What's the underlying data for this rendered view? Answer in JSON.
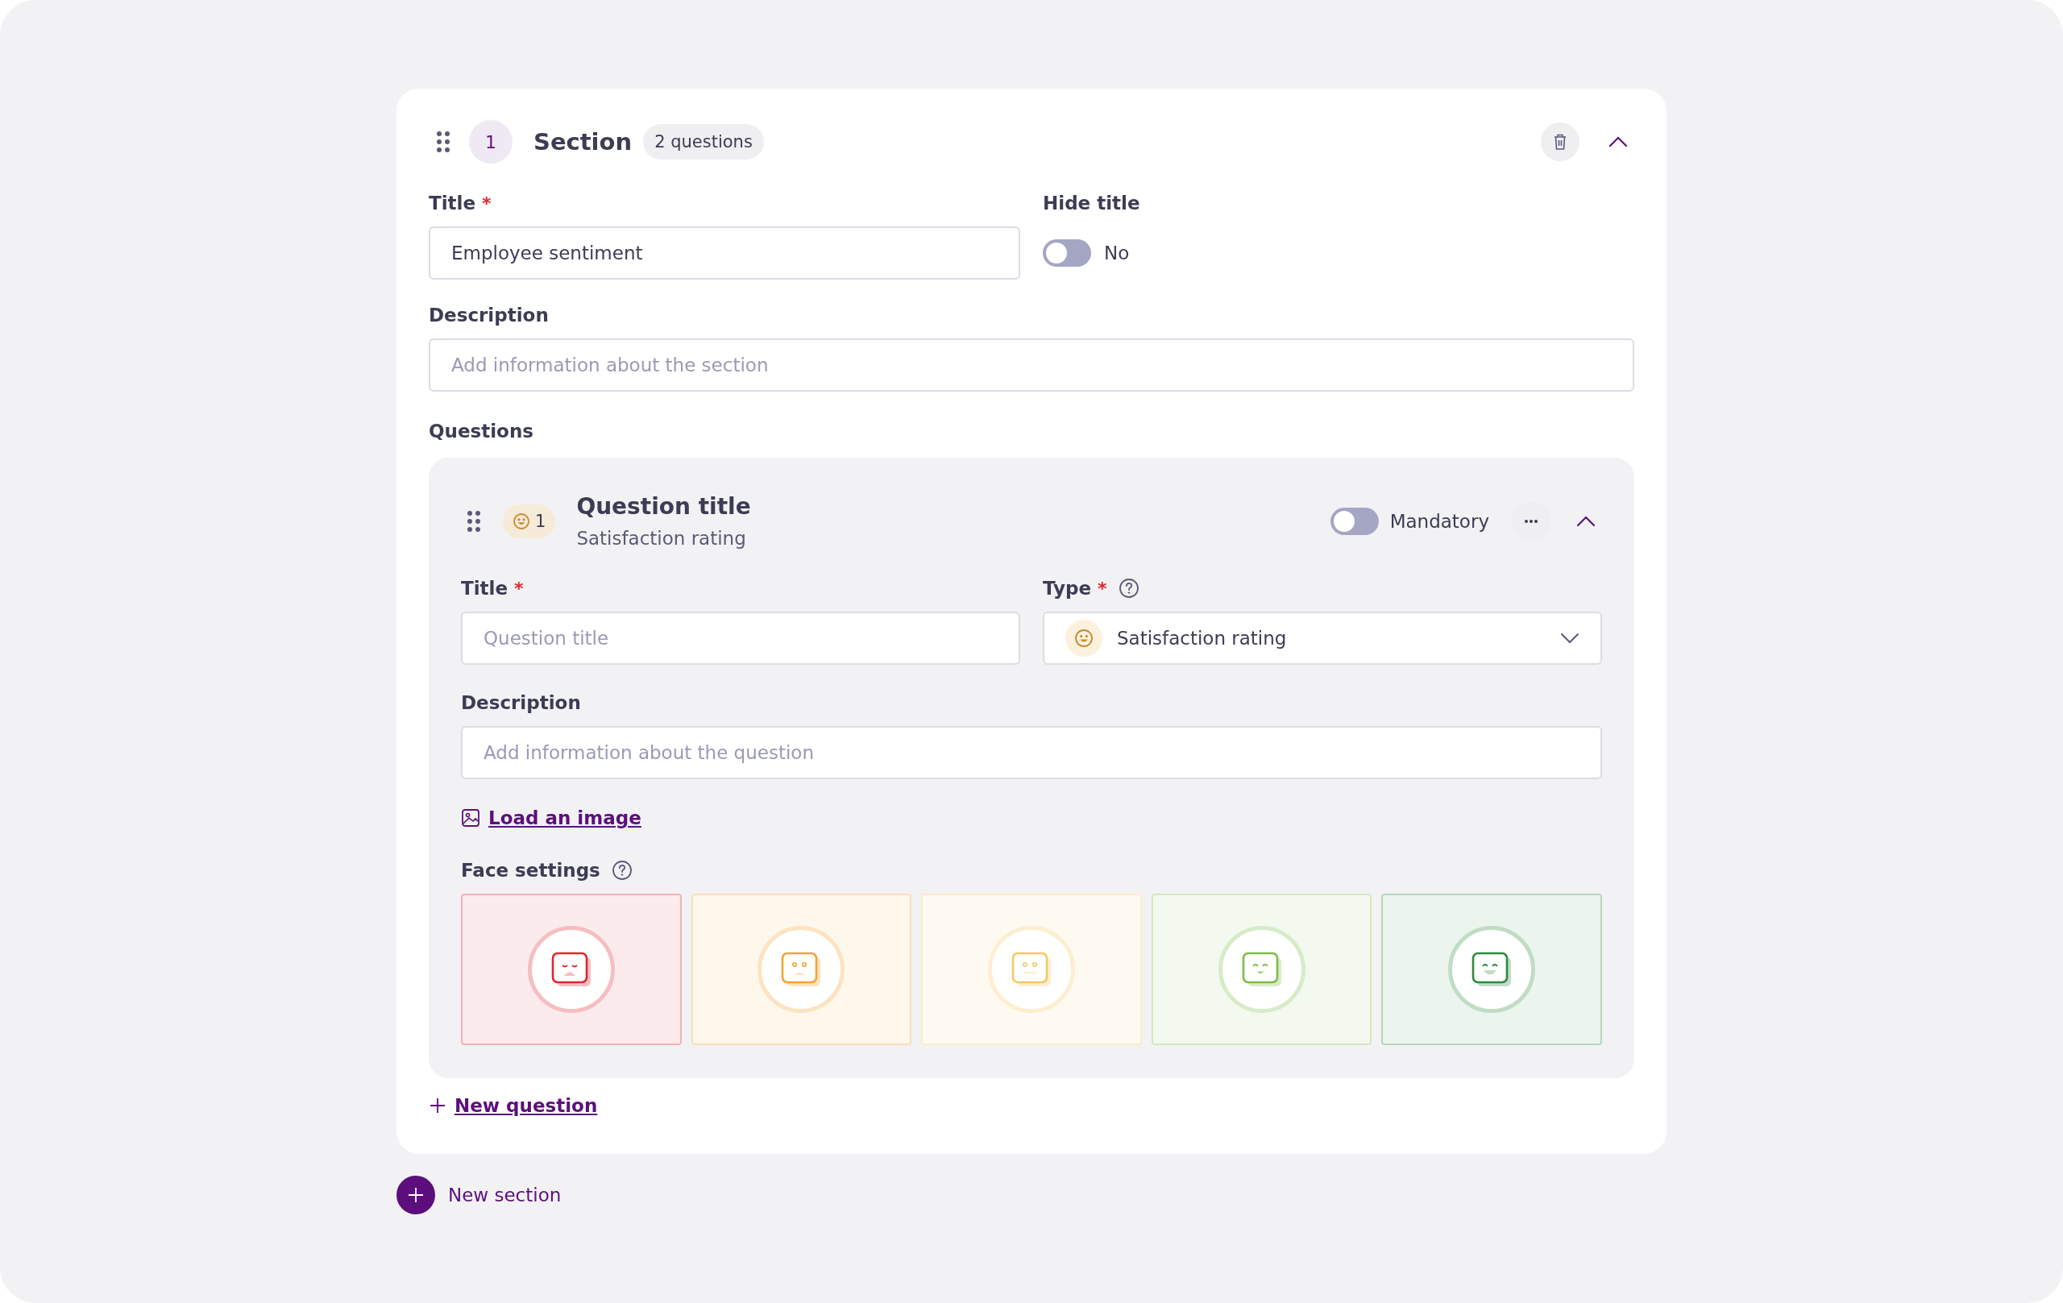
{
  "section": {
    "number": "1",
    "title": "Section",
    "count_badge": "2 questions",
    "expanded": true,
    "title_field": {
      "label": "Title",
      "required_mark": "*",
      "value": "Employee sentiment"
    },
    "hide_title": {
      "label": "Hide title",
      "on": false,
      "state_label": "No"
    },
    "description_field": {
      "label": "Description",
      "placeholder": "Add information about the section"
    },
    "questions_label": "Questions",
    "questions": [
      {
        "number": "1",
        "title": "Question title",
        "subtitle": "Satisfaction rating",
        "expanded": true,
        "mandatory": {
          "label": "Mandatory",
          "on": false
        },
        "title_field": {
          "label": "Title",
          "required_mark": "*",
          "placeholder": "Question title"
        },
        "type_field": {
          "label": "Type",
          "required_mark": "*",
          "value": "Satisfaction rating"
        },
        "description_field": {
          "label": "Description",
          "placeholder": "Add information about the question"
        },
        "image_link": "Load an image",
        "face_settings_label": "Face settings",
        "faces": [
          {
            "kind": "very_sad",
            "color": "#e0262f"
          },
          {
            "kind": "sad",
            "color": "#f5a331"
          },
          {
            "kind": "neutral",
            "color": "#f6c862"
          },
          {
            "kind": "happy",
            "color": "#7dbd4a"
          },
          {
            "kind": "very_happy",
            "color": "#2e8a3f"
          }
        ]
      }
    ],
    "new_question": "New question"
  },
  "new_section": "New section"
}
